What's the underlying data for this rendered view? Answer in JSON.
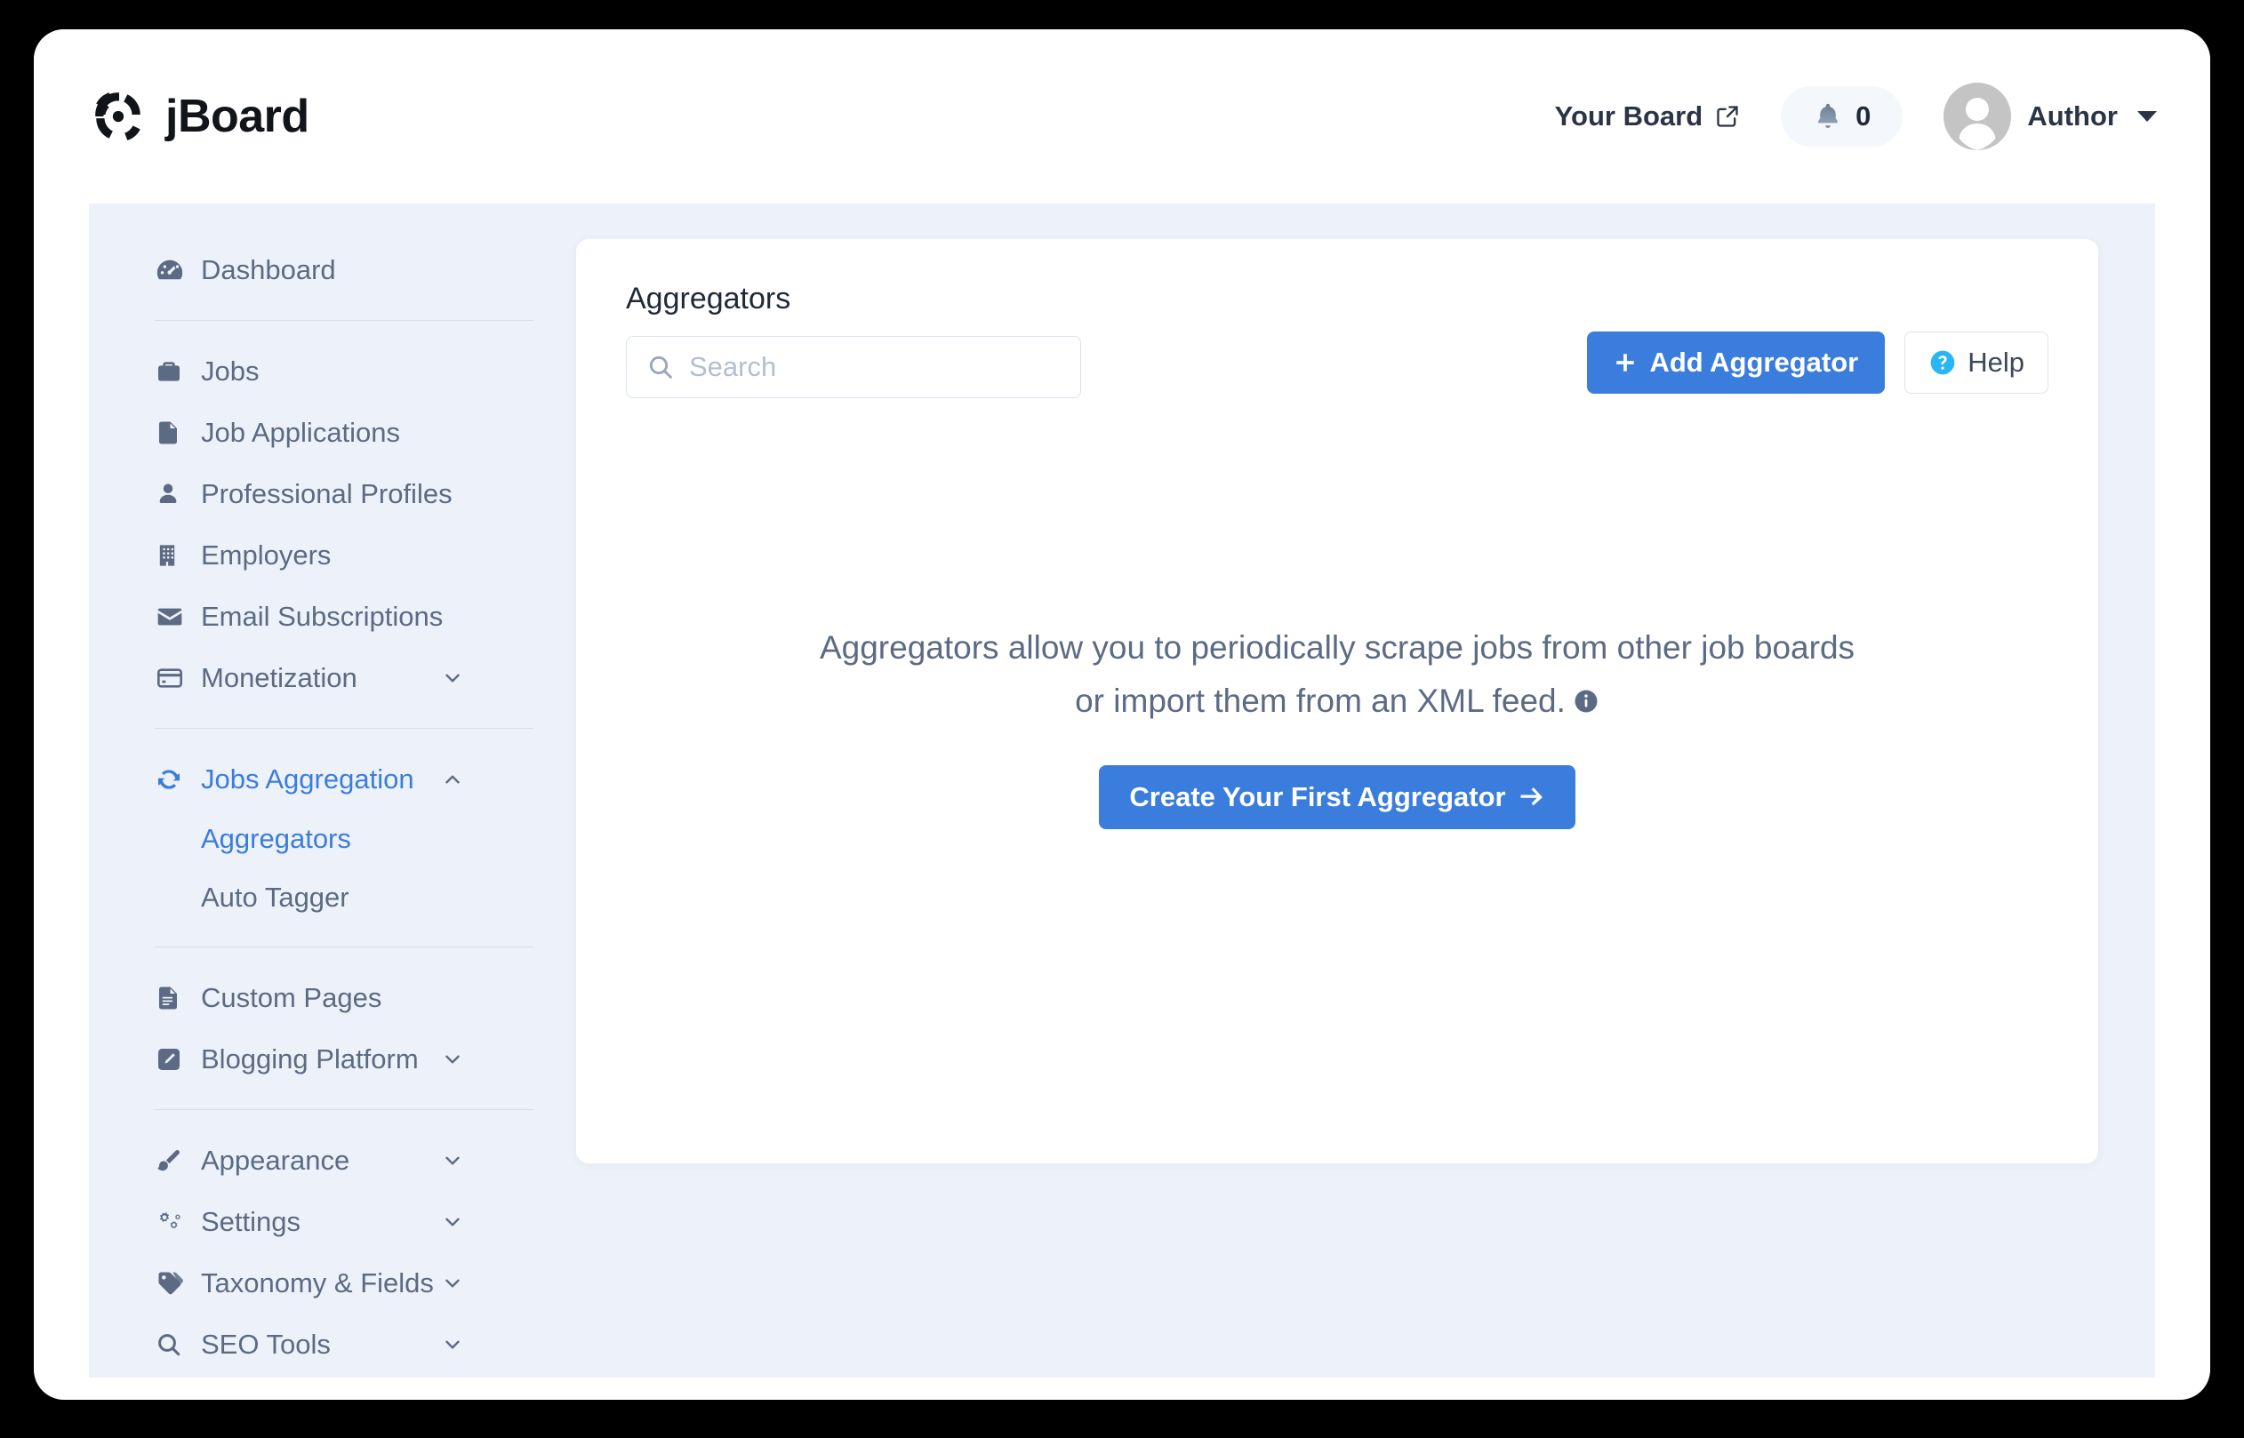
{
  "brand": {
    "name": "jBoard",
    "logo_icon": "jboard-pinwheel-logo"
  },
  "header": {
    "your_board_label": "Your Board",
    "external_link_icon": "external-link-icon",
    "bell_icon": "bell-icon",
    "notification_count": "0",
    "user_name": "Author",
    "avatar_icon": "user-avatar-icon",
    "caret_icon": "chevron-down-icon"
  },
  "sidebar": {
    "groups": [
      {
        "items": [
          {
            "label": "Dashboard",
            "icon": "dashboard-gauge-icon",
            "active": false,
            "expandable": false
          }
        ]
      },
      {
        "items": [
          {
            "label": "Jobs",
            "icon": "briefcase-icon",
            "active": false,
            "expandable": false
          },
          {
            "label": "Job Applications",
            "icon": "file-icon",
            "active": false,
            "expandable": false
          },
          {
            "label": "Professional Profiles",
            "icon": "user-icon",
            "active": false,
            "expandable": false
          },
          {
            "label": "Employers",
            "icon": "building-icon",
            "active": false,
            "expandable": false
          },
          {
            "label": "Email Subscriptions",
            "icon": "envelope-icon",
            "active": false,
            "expandable": false
          },
          {
            "label": "Monetization",
            "icon": "credit-card-icon",
            "active": false,
            "expandable": true,
            "expanded": false
          }
        ]
      },
      {
        "items": [
          {
            "label": "Jobs Aggregation",
            "icon": "sync-icon",
            "active": true,
            "expandable": true,
            "expanded": true,
            "children": [
              {
                "label": "Aggregators",
                "active": true
              },
              {
                "label": "Auto Tagger",
                "active": false
              }
            ]
          }
        ]
      },
      {
        "items": [
          {
            "label": "Custom Pages",
            "icon": "document-lines-icon",
            "active": false,
            "expandable": false
          },
          {
            "label": "Blogging Platform",
            "icon": "pencil-square-icon",
            "active": false,
            "expandable": true,
            "expanded": false
          }
        ]
      },
      {
        "items": [
          {
            "label": "Appearance",
            "icon": "paint-brush-icon",
            "active": false,
            "expandable": true,
            "expanded": false
          },
          {
            "label": "Settings",
            "icon": "gears-icon",
            "active": false,
            "expandable": true,
            "expanded": false
          },
          {
            "label": "Taxonomy & Fields",
            "icon": "tags-icon",
            "active": false,
            "expandable": true,
            "expanded": false
          },
          {
            "label": "SEO Tools",
            "icon": "search-icon",
            "active": false,
            "expandable": true,
            "expanded": false
          }
        ]
      }
    ]
  },
  "main": {
    "title": "Aggregators",
    "search": {
      "value": "",
      "placeholder": "Search",
      "icon": "search-icon"
    },
    "add_button": {
      "label": "Add Aggregator",
      "icon": "plus-icon"
    },
    "help_button": {
      "label": "Help",
      "icon": "question-circle-icon"
    },
    "empty_state": {
      "line1": "Aggregators allow you to periodically scrape jobs from other job boards",
      "line2": "or import them from an XML feed.",
      "info_icon": "info-circle-icon",
      "cta_label": "Create Your First Aggregator",
      "cta_icon": "arrow-right-icon"
    }
  },
  "colors": {
    "accent_blue": "#3b7ddd",
    "sidebar_text": "#5c6b83",
    "body_bg": "#edf1f9",
    "help_icon_cyan": "#29b6f6"
  }
}
